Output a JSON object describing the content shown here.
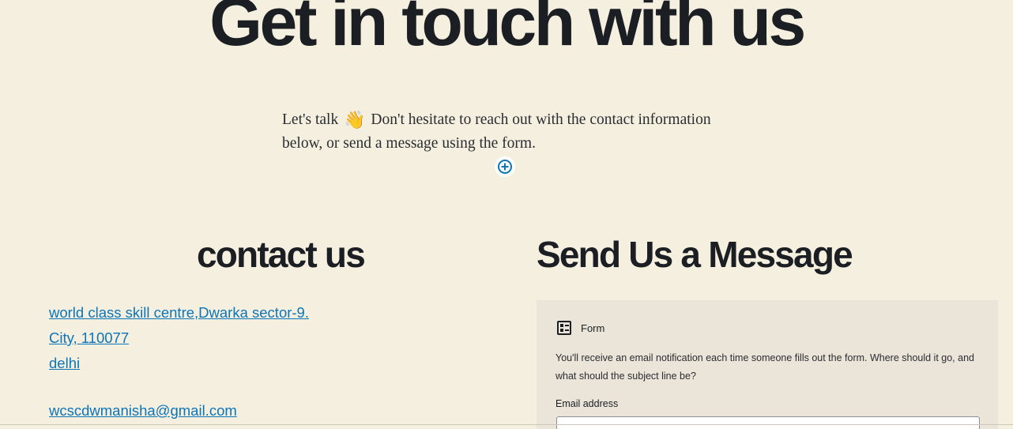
{
  "hero": {
    "title": "Get in touch with us",
    "intro_before": "Let's talk",
    "emoji": "👋",
    "intro_after": "Don't hesitate to reach out with the contact information below, or send a message using the form."
  },
  "inserter": {
    "icon": "plus-circle-icon",
    "color": "#0b75b8"
  },
  "contact": {
    "title": "contact us",
    "address_line1": "world class skill centre,Dwarka sector-9.",
    "address_line2": "City, 110077",
    "address_line3": "delhi",
    "email": "wcscdwmanisha@gmail.com"
  },
  "message": {
    "title": "Send Us a Message",
    "form": {
      "icon": "form-icon",
      "label": "Form",
      "description": "You'll receive an email notification each time someone fills out the form. Where should it go, and what should the subject line be?",
      "email_label": "Email address",
      "email_value": ""
    }
  },
  "colors": {
    "background": "#f5efe0",
    "panel": "#ebe4d9",
    "link": "#0b75b8",
    "text": "#1b1e22"
  }
}
